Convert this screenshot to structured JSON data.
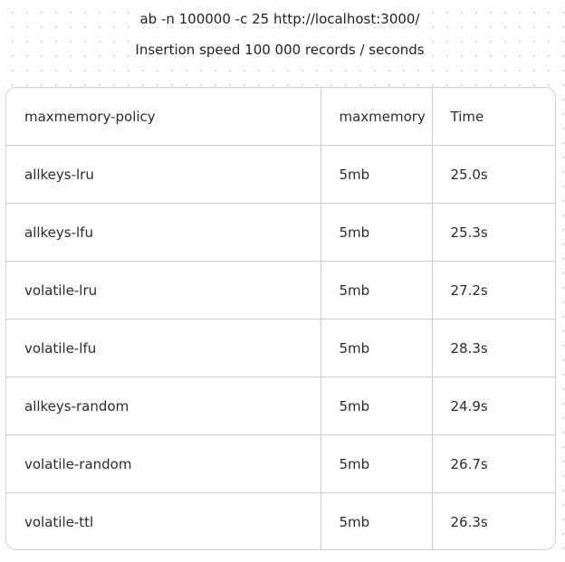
{
  "header": {
    "command": "ab -n 100000 -c 25 http://localhost:3000/",
    "subtitle": "Insertion speed 100 000 records / seconds"
  },
  "table": {
    "columns": [
      "maxmemory-policy",
      "maxmemory",
      "Time"
    ],
    "rows": [
      [
        "allkeys-lru",
        "5mb",
        "25.0s"
      ],
      [
        "allkeys-lfu",
        "5mb",
        "25.3s"
      ],
      [
        "volatile-lru",
        "5mb",
        "27.2s"
      ],
      [
        "volatile-lfu",
        "5mb",
        "28.3s"
      ],
      [
        "allkeys-random",
        "5mb",
        "24.9s"
      ],
      [
        "volatile-random",
        "5mb",
        "26.7s"
      ],
      [
        "volatile-ttl",
        "5mb",
        "26.3s"
      ]
    ]
  }
}
